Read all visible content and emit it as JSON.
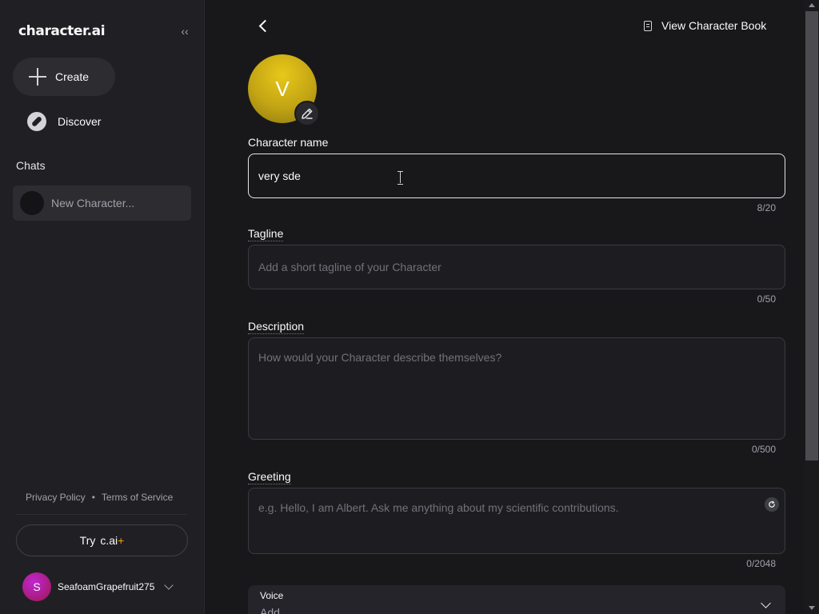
{
  "sidebar": {
    "logo": "character.ai",
    "collapse_icon": "double-chevron-left-icon",
    "collapse_glyph": "‹‹",
    "create_label": "Create",
    "discover_label": "Discover",
    "chats_heading": "Chats",
    "chats": [
      {
        "label": "New Character..."
      }
    ],
    "privacy_label": "Privacy Policy",
    "legal_separator": "•",
    "terms_label": "Terms of Service",
    "try_prefix": "Try",
    "try_brand": "c.ai",
    "try_plus": "+",
    "user": {
      "initial": "S",
      "name": "SeafoamGrapefruit275"
    }
  },
  "main": {
    "view_book_label": "View Character Book",
    "avatar_initial": "V",
    "fields": {
      "name": {
        "label": "Character name",
        "value": "very sde",
        "counter": "8/20"
      },
      "tagline": {
        "label": "Tagline",
        "placeholder": "Add a short tagline of your Character",
        "counter": "0/50"
      },
      "description": {
        "label": "Description",
        "placeholder": "How would your Character describe themselves?",
        "counter": "0/500"
      },
      "greeting": {
        "label": "Greeting",
        "placeholder": "e.g. Hello, I am Albert. Ask me anything about my scientific contributions.",
        "counter": "0/2048"
      },
      "voice": {
        "label": "Voice",
        "value": "Add"
      }
    }
  },
  "colors": {
    "background": "#18181b",
    "sidebar": "#202024",
    "accent_plus": "#f59e0b",
    "avatar": "#c3a414",
    "user_avatar": "#c026d3"
  }
}
